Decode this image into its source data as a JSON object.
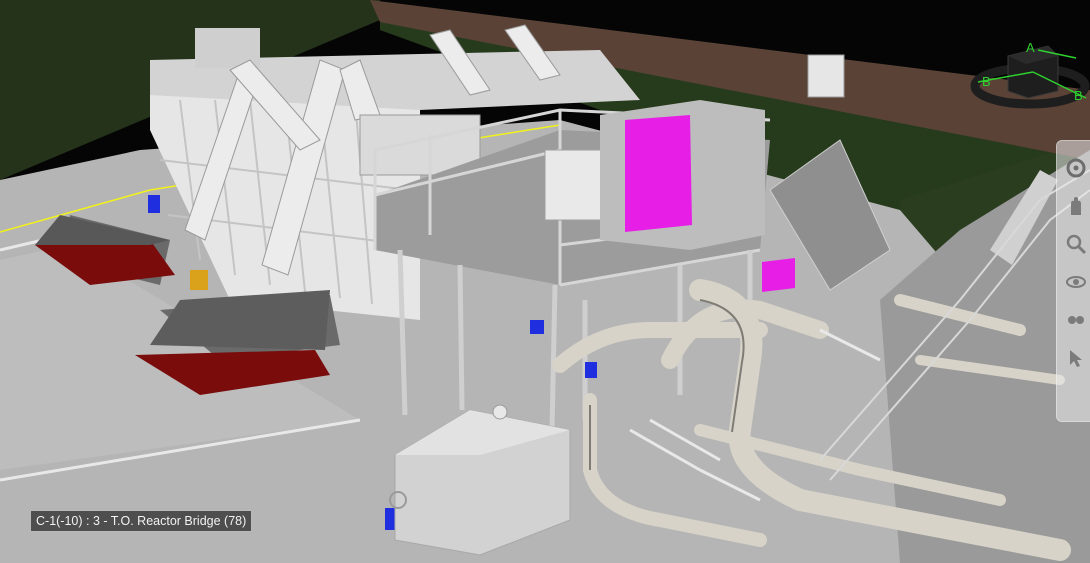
{
  "viewport": {
    "status_label": "C-1(-10) : 3 - T.O. Reactor Bridge (78)"
  },
  "viewcube": {
    "face_label_a": "A",
    "face_label_b_left": "B",
    "face_label_b_right": "B",
    "axis_color": "#2fd12f"
  },
  "navigation_bar": {
    "icons": [
      "steering-wheel-icon",
      "pan-icon",
      "zoom-icon",
      "orbit-icon",
      "look-icon",
      "select-cursor-icon"
    ]
  },
  "colors": {
    "background": "#050505",
    "ground": "#b8b8b8",
    "grass": "#2b3a1f",
    "hoppers": "#7a0c0c",
    "highlight_panel": "#e61ee6",
    "valves": "#1f2fe0",
    "selection_line": "#f2f21a"
  }
}
